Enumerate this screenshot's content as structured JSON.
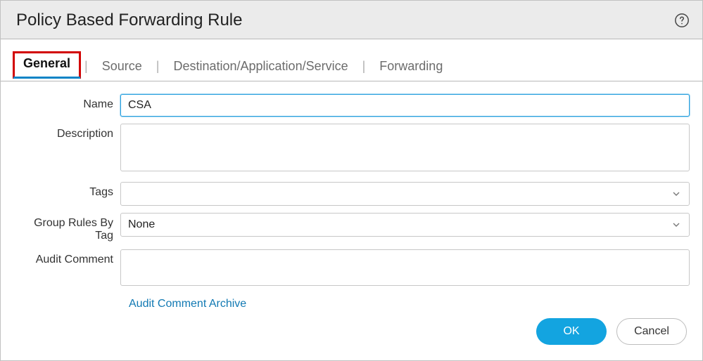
{
  "dialog": {
    "title": "Policy Based Forwarding Rule"
  },
  "tabs": {
    "general": "General",
    "source": "Source",
    "dest": "Destination/Application/Service",
    "forwarding": "Forwarding"
  },
  "labels": {
    "name": "Name",
    "description": "Description",
    "tags": "Tags",
    "group_by": "Group Rules By Tag",
    "audit": "Audit Comment"
  },
  "values": {
    "name": "CSA",
    "description": "",
    "tags_display": "",
    "group_by": "None",
    "audit": ""
  },
  "link": {
    "audit_archive": "Audit Comment Archive"
  },
  "buttons": {
    "ok": "OK",
    "cancel": "Cancel"
  }
}
